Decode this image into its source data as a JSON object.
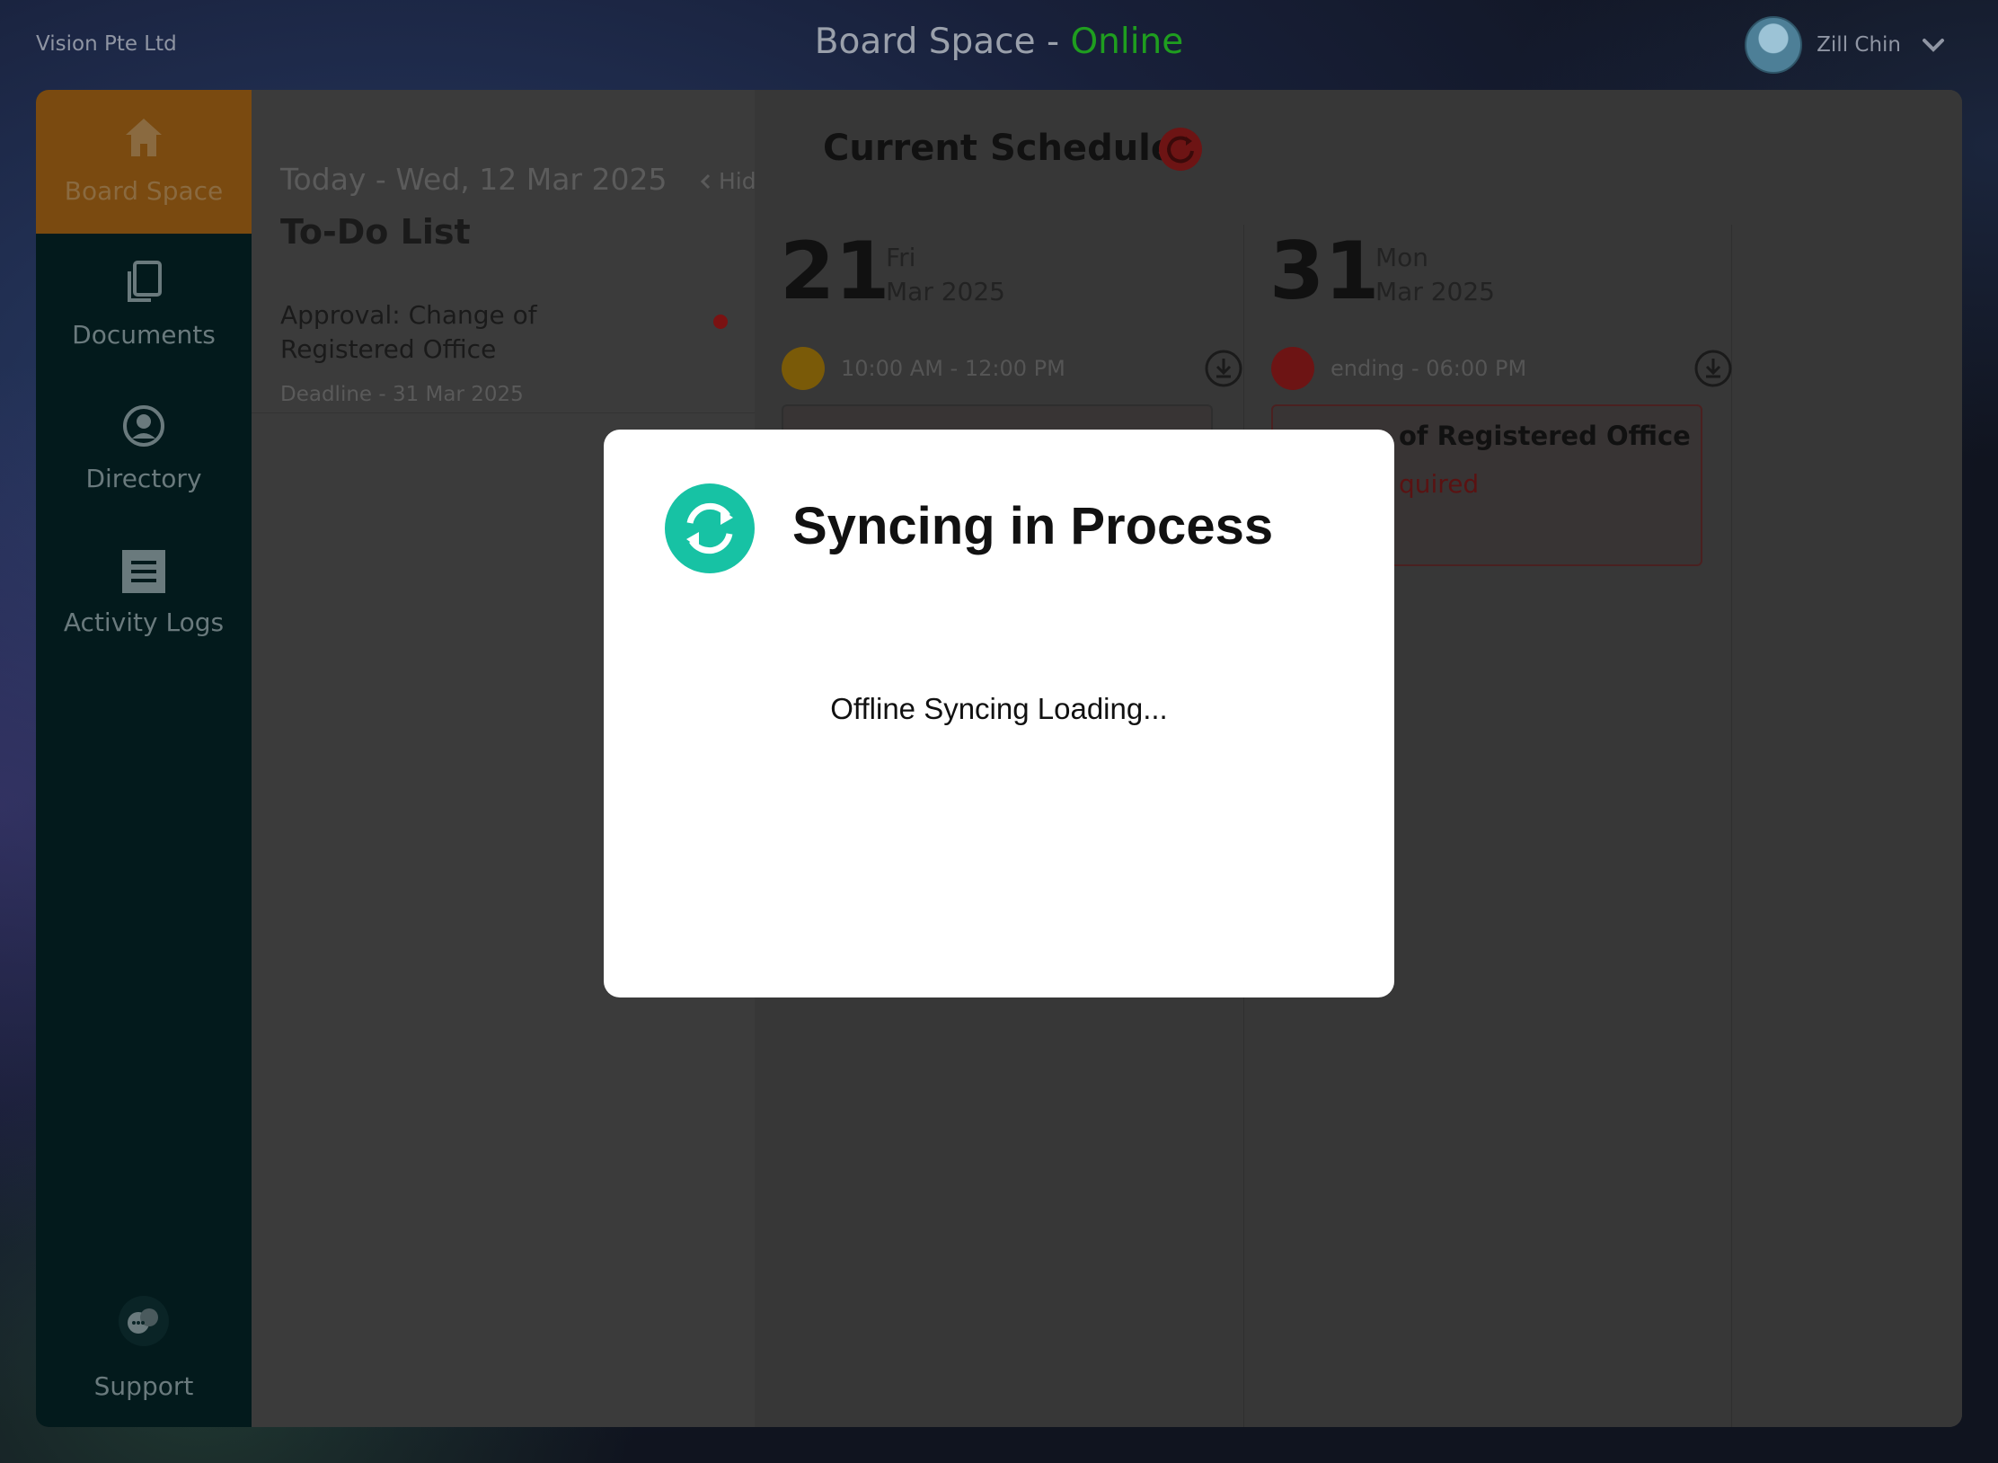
{
  "header": {
    "org_name": "Vision Pte Ltd",
    "title": "Board Space - ",
    "status": "Online",
    "user_name": "Zill Chin"
  },
  "sidebar": {
    "items": [
      {
        "label": "Board Space",
        "icon": "home-icon",
        "active": true
      },
      {
        "label": "Documents",
        "icon": "documents-icon"
      },
      {
        "label": "Directory",
        "icon": "user-circle-icon"
      },
      {
        "label": "Activity Logs",
        "icon": "list-icon"
      }
    ],
    "support_label": "Support"
  },
  "todo": {
    "today": "Today - Wed, 12 Mar 2025",
    "hide_label": "Hide",
    "title": "To-Do List",
    "items": [
      {
        "title": "Approval: Change of Registered Office",
        "deadline": "Deadline - 31 Mar 2025"
      }
    ]
  },
  "schedule": {
    "title": "Current Schedule",
    "days": [
      {
        "num": "21",
        "dow": "Fri",
        "month": "Mar 2025",
        "time": "10:00 AM - 12:00 PM",
        "icon_color": "#7a5a08",
        "card_title": "",
        "card_sub": ""
      },
      {
        "num": "31",
        "dow": "Mon",
        "month": "Mar 2025",
        "time": "ending - 06:00 PM",
        "icon_color": "#6d1414",
        "card_title": "of Registered Office",
        "card_sub": "quired"
      }
    ]
  },
  "modal": {
    "title": "Syncing in Process",
    "message": "Offline Syncing Loading...",
    "accent_color": "#17c2a4"
  }
}
